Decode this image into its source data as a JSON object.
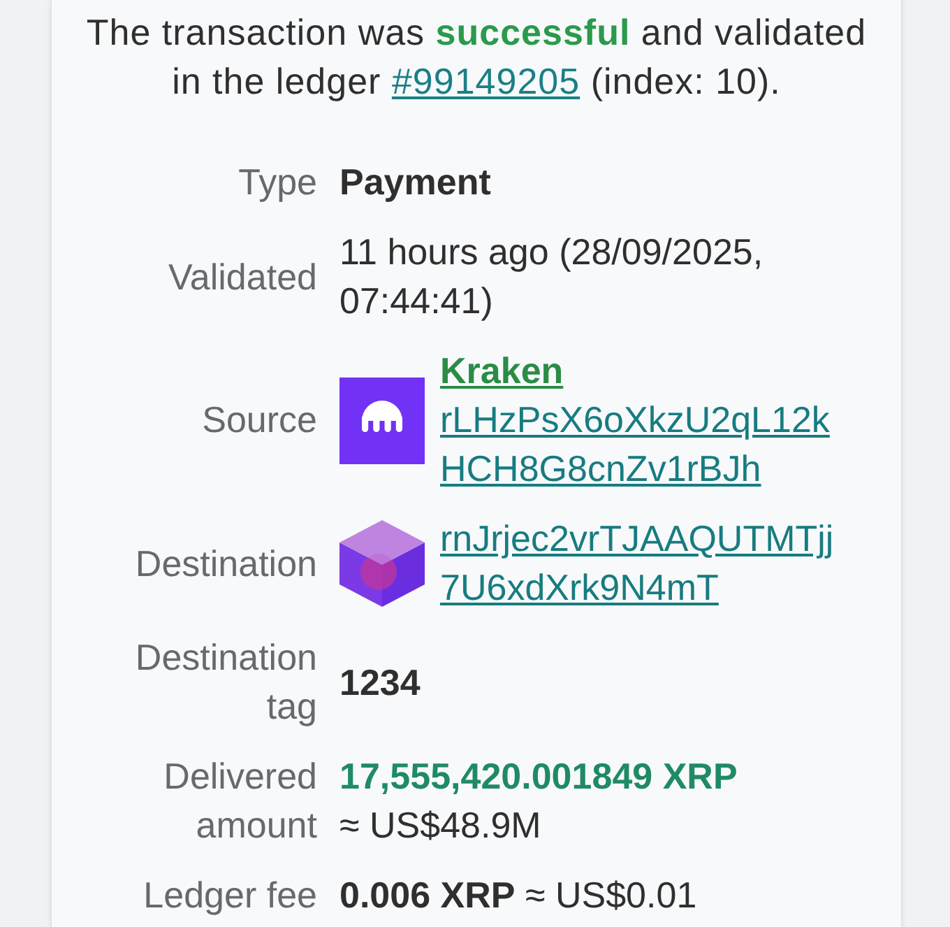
{
  "status": {
    "text": "The transaction was **successful** and validated in the ledger",
    "ledger_link": "#99149205",
    "index_note": "(index: 10)."
  },
  "details": [
    {
      "label": "Type",
      "kind": "strong",
      "value": "Payment"
    },
    {
      "label": "Validated",
      "kind": "text",
      "value": "11 hours ago (28/09/2025, 07:44:41)"
    },
    {
      "label": "Source",
      "kind": "named_account",
      "name": "Kraken",
      "address": "rLHzPsX6oXkzU2qL12kHCH8G8cnZv1rBJh"
    },
    {
      "label": "Destination",
      "kind": "account",
      "address": "rnJrjec2vrTJAAQUTMTjj7U6xdXrk9N4mT"
    },
    {
      "label": "Destination tag",
      "kind": "strong",
      "value": "1234"
    },
    {
      "label": "Delivered amount",
      "kind": "amount",
      "amount": "17,555,420.001849 XRP",
      "fiat": "≈ US$48.9M",
      "highlighted": true
    },
    {
      "label": "Ledger fee",
      "kind": "amount",
      "amount": "0.006 XRP",
      "fiat": "≈ US$0.01",
      "highlighted": false
    }
  ]
}
